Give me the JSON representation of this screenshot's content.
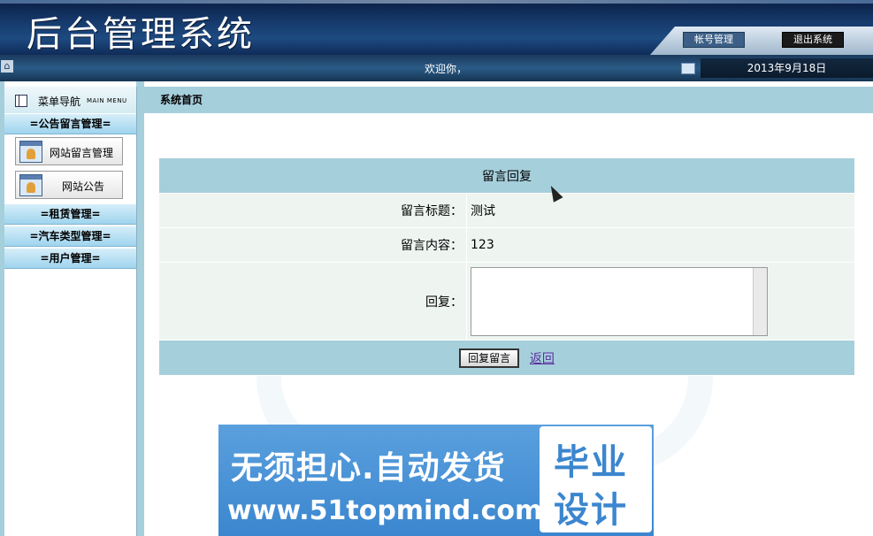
{
  "header": {
    "title": "后台管理系统",
    "account_button": "帐号管理",
    "logout_button": "退出系统"
  },
  "statusbar": {
    "welcome": "欢迎你，",
    "date": "2013年9月18日"
  },
  "sidebar": {
    "title": "菜单导航",
    "subtitle": "MAIN MENU",
    "groups": [
      {
        "label": "=公告留言管理=",
        "items": [
          "网站留言管理",
          "网站公告"
        ]
      },
      {
        "label": "=租赁管理="
      },
      {
        "label": "=汽车类型管理="
      },
      {
        "label": "=用户管理="
      }
    ]
  },
  "content": {
    "breadcrumb": "系统首页",
    "form": {
      "caption": "留言回复",
      "title_label": "留言标题：",
      "title_value": "测试",
      "content_label": "留言内容：",
      "content_value": "123",
      "reply_label": "回复：",
      "reply_value": "",
      "submit_button": "回复留言",
      "back_link": "返回"
    }
  },
  "banner": {
    "line1": "无须担心.自动发货",
    "line2": "www.51topmind.com",
    "badge_line1": "毕业",
    "badge_line2": "设计"
  },
  "colors": {
    "header": "#173d70",
    "panel": "#a6cfdc",
    "row": "#eef5f1",
    "banner": "#3b86cf"
  }
}
